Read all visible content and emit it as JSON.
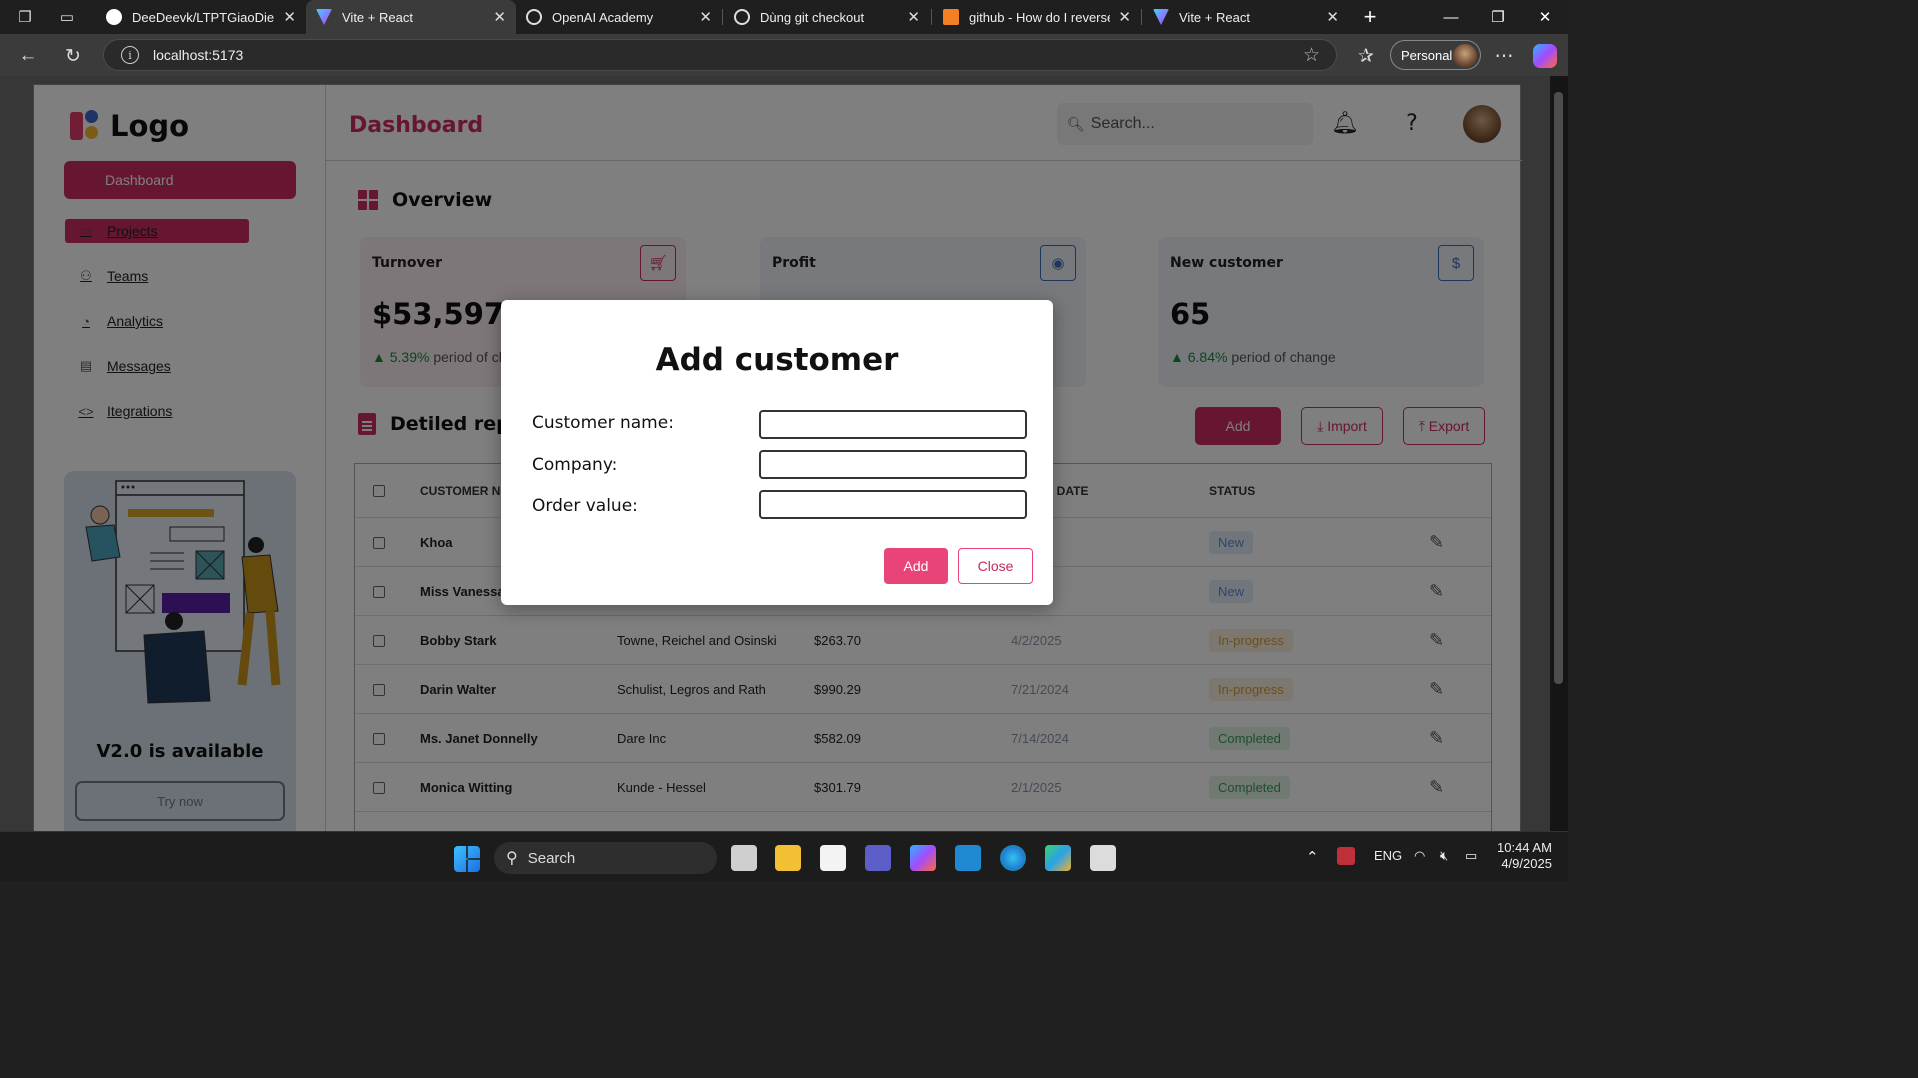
{
  "browser": {
    "tabs": [
      {
        "label": "DeeDeevk/LTPTGiaoDien_N",
        "color": "#ffffff",
        "icon": "github-icon"
      },
      {
        "label": "Vite + React",
        "color": "#a66bff",
        "icon": "vite-icon"
      },
      {
        "label": "OpenAI Academy",
        "color": "#dddddd",
        "icon": "openai-icon"
      },
      {
        "label": "Dùng git checkout",
        "color": "#dddddd",
        "icon": "openai-icon"
      },
      {
        "label": "github - How do I reverse a",
        "color": "#f48024",
        "icon": "stackoverflow-icon"
      },
      {
        "label": "Vite + React",
        "color": "#a66bff",
        "icon": "vite-icon"
      }
    ],
    "url": "localhost:5173",
    "profile": "Personal"
  },
  "sidebar": {
    "logo": "Logo",
    "dashboard": "Dashboard",
    "items": [
      {
        "label": "Projects",
        "icon": "folder-icon"
      },
      {
        "label": "Teams",
        "icon": "teams-icon"
      },
      {
        "label": "Analytics",
        "icon": "pie-chart-icon"
      },
      {
        "label": "Messages",
        "icon": "message-icon"
      },
      {
        "label": "Itegrations",
        "icon": "code-icon"
      }
    ],
    "promo": {
      "title": "V2.0 is available",
      "button": "Try now"
    }
  },
  "header": {
    "title": "Dashboard",
    "search_placeholder": "Search...",
    "help": "?"
  },
  "overview": {
    "title": "Overview",
    "cards": [
      {
        "title": "Turnover",
        "value": "$53,597",
        "change": "5.39%",
        "change_text": "period of change",
        "icon": "cart-icon",
        "accent": "#cd2c62"
      },
      {
        "title": "Profit",
        "value": "",
        "change": "",
        "change_text": "",
        "icon": "user-circle-icon",
        "accent": "#3d6fb8"
      },
      {
        "title": "New customer",
        "value": "65",
        "change": "6.84%",
        "change_text": "period of change",
        "icon": "dollar-icon",
        "accent": "#3d6fb8"
      }
    ]
  },
  "report": {
    "title": "Detiled report",
    "buttons": {
      "add": "Add",
      "import": "Import",
      "export": "Export"
    },
    "columns": [
      "CUSTOMER NAME",
      "ORDER DATE",
      "STATUS"
    ],
    "rows": [
      {
        "name": "Khoa",
        "company": "",
        "value": "",
        "date": "…5",
        "status": "New"
      },
      {
        "name": "Miss Vanessa",
        "company": "",
        "value": "",
        "date": "…024",
        "status": "New"
      },
      {
        "name": "Bobby Stark",
        "company": "Towne, Reichel and Osinski",
        "value": "$263.70",
        "date": "4/2/2025",
        "status": "In-progress"
      },
      {
        "name": "Darin Walter",
        "company": "Schulist, Legros and Rath",
        "value": "$990.29",
        "date": "7/21/2024",
        "status": "In-progress"
      },
      {
        "name": "Ms. Janet Donnelly",
        "company": "Dare Inc",
        "value": "$582.09",
        "date": "7/14/2024",
        "status": "Completed"
      },
      {
        "name": "Monica Witting",
        "company": "Kunde - Hessel",
        "value": "$301.79",
        "date": "2/1/2025",
        "status": "Completed"
      }
    ]
  },
  "modal": {
    "title": "Add customer",
    "fields": [
      {
        "label": "Customer name:",
        "value": ""
      },
      {
        "label": "Company:",
        "value": ""
      },
      {
        "label": "Order value:",
        "value": ""
      }
    ],
    "add": "Add",
    "close": "Close"
  },
  "taskbar": {
    "search": "Search",
    "lang": "ENG",
    "time": "10:44 AM",
    "date": "4/9/2025"
  }
}
